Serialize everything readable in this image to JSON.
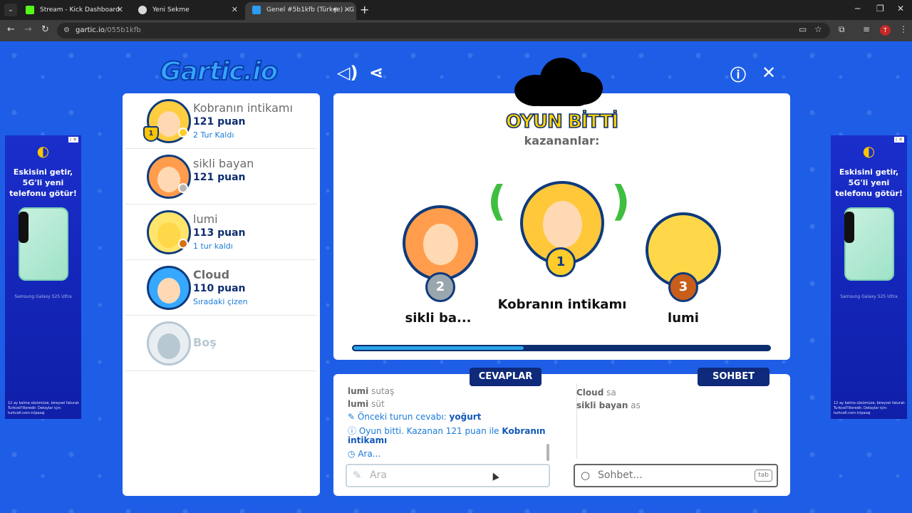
{
  "browser": {
    "tabs": [
      {
        "title": "Stream - Kick Dashboard",
        "favicon_color": "#53fc18"
      },
      {
        "title": "Yeni Sekme",
        "favicon_color": "#d9d9d9"
      },
      {
        "title": "Genel #5b1kfb (Türkçe) - G",
        "favicon_color": "#2c9cf2"
      }
    ],
    "new_tab": "+",
    "url_host": "gartic.io",
    "url_path": "/055b1kfb",
    "profile_initial": "T"
  },
  "game": {
    "logo": "Gartic.io"
  },
  "ad": {
    "headline": "Eskisini getir, 5G'li yeni telefonu götür!",
    "product": "Samsung Galaxy S25 Ultra",
    "footer": "12 ay kalma sözümüze, bireysel faturalı Turkcell'lileredir. Detaylar için: turkcell.com.tr/pasaj"
  },
  "players": [
    {
      "name": "Kobranın intikamı",
      "score": "121 puan",
      "status": "2 Tur Kaldı",
      "badge_color": "#ffcc29",
      "trophy": "1"
    },
    {
      "name": "sikli bayan",
      "score": "121 puan",
      "status": "",
      "badge_color": "#b5b5b5"
    },
    {
      "name": "lumi",
      "score": "113 puan",
      "status": "1 tur kaldı",
      "badge_color": "#d86f10"
    },
    {
      "name": "Cloud",
      "score": "110 puan",
      "status": "Sıradaki çizen"
    },
    {
      "name": "Boş"
    }
  ],
  "result": {
    "title": "OYUN BİTTİ",
    "subtitle": "kazananlar:",
    "first": {
      "name": "Kobranın intikamı",
      "place": "1"
    },
    "second": {
      "name": "sikli ba...",
      "place": "2"
    },
    "third": {
      "name": "lumi",
      "place": "3"
    },
    "progress": 0.41
  },
  "answers": {
    "tab_label": "CEVAPLAR",
    "messages": [
      {
        "user": "lumi",
        "text": "sutaş"
      },
      {
        "user": "lumi",
        "text": "süt"
      }
    ],
    "previous_answer_label": "Önceki turun cevabı:",
    "previous_answer": "yoğurt",
    "game_over_text": "Oyun bitti. Kazanan 121 puan ile",
    "game_over_winner": "Kobranın intikamı",
    "searching": "Ara...",
    "input_placeholder": "Ara"
  },
  "chat": {
    "tab_label": "SOHBET",
    "messages": [
      {
        "user": "Cloud",
        "text": "sa"
      },
      {
        "user": "sikli bayan",
        "text": "as"
      }
    ],
    "input_placeholder": "Sohbet...",
    "tab_hint": "tab"
  }
}
